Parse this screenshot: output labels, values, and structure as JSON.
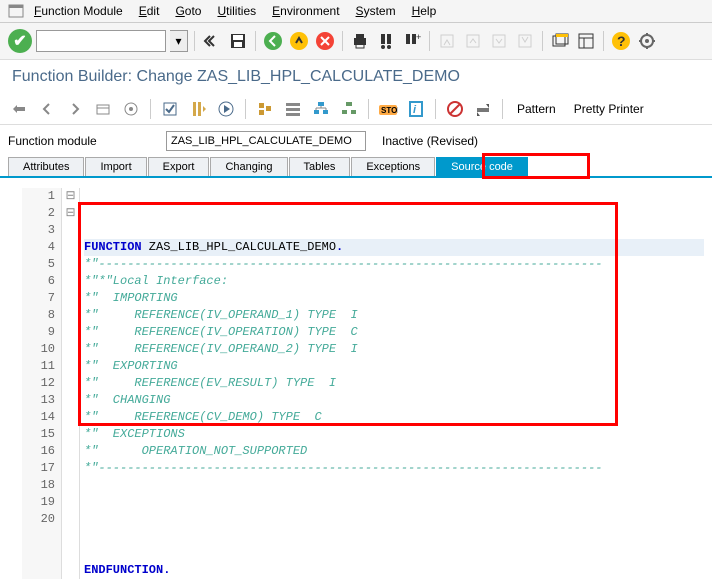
{
  "menubar": {
    "items": [
      "Function Module",
      "Edit",
      "Goto",
      "Utilities",
      "Environment",
      "System",
      "Help"
    ]
  },
  "title": "Function Builder: Change ZAS_LIB_HPL_CALCULATE_DEMO",
  "toolbar2": {
    "pattern": "Pattern",
    "pretty": "Pretty Printer"
  },
  "fm": {
    "label": "Function module",
    "value": "ZAS_LIB_HPL_CALCULATE_DEMO",
    "status": "Inactive (Revised)"
  },
  "tabs": [
    "Attributes",
    "Import",
    "Export",
    "Changing",
    "Tables",
    "Exceptions",
    "Source code"
  ],
  "code": {
    "lines": [
      {
        "n": 1,
        "fold": "⊟",
        "seg": [
          {
            "cls": "kw",
            "t": "FUNCTION"
          },
          {
            "cls": "ident",
            "t": " ZAS_LIB_HPL_CALCULATE_DEMO"
          },
          {
            "cls": "kw",
            "t": "."
          }
        ]
      },
      {
        "n": 2,
        "fold": "⊟",
        "seg": [
          {
            "cls": "cmt",
            "t": "*\"----------------------------------------------------------------------"
          }
        ]
      },
      {
        "n": 3,
        "fold": "",
        "seg": [
          {
            "cls": "cmt",
            "t": "*\"*\"Local Interface:"
          }
        ]
      },
      {
        "n": 4,
        "fold": "",
        "seg": [
          {
            "cls": "cmt",
            "t": "*\"  IMPORTING"
          }
        ]
      },
      {
        "n": 5,
        "fold": "",
        "seg": [
          {
            "cls": "cmt",
            "t": "*\"     REFERENCE(IV_OPERAND_1) TYPE  I"
          }
        ]
      },
      {
        "n": 6,
        "fold": "",
        "seg": [
          {
            "cls": "cmt",
            "t": "*\"     REFERENCE(IV_OPERATION) TYPE  C"
          }
        ]
      },
      {
        "n": 7,
        "fold": "",
        "seg": [
          {
            "cls": "cmt",
            "t": "*\"     REFERENCE(IV_OPERAND_2) TYPE  I"
          }
        ]
      },
      {
        "n": 8,
        "fold": "",
        "seg": [
          {
            "cls": "cmt",
            "t": "*\"  EXPORTING"
          }
        ]
      },
      {
        "n": 9,
        "fold": "",
        "seg": [
          {
            "cls": "cmt",
            "t": "*\"     REFERENCE(EV_RESULT) TYPE  I"
          }
        ]
      },
      {
        "n": 10,
        "fold": "",
        "seg": [
          {
            "cls": "cmt",
            "t": "*\"  CHANGING"
          }
        ]
      },
      {
        "n": 11,
        "fold": "",
        "seg": [
          {
            "cls": "cmt",
            "t": "*\"     REFERENCE(CV_DEMO) TYPE  C"
          }
        ]
      },
      {
        "n": 12,
        "fold": "",
        "seg": [
          {
            "cls": "cmt",
            "t": "*\"  EXCEPTIONS"
          }
        ]
      },
      {
        "n": 13,
        "fold": "",
        "seg": [
          {
            "cls": "cmt",
            "t": "*\"      OPERATION_NOT_SUPPORTED"
          }
        ]
      },
      {
        "n": 14,
        "fold": "",
        "seg": [
          {
            "cls": "cmt",
            "t": "*\"----------------------------------------------------------------------"
          }
        ]
      },
      {
        "n": 15,
        "fold": "",
        "seg": []
      },
      {
        "n": 16,
        "fold": "",
        "seg": []
      },
      {
        "n": 17,
        "fold": "",
        "seg": []
      },
      {
        "n": 18,
        "fold": "",
        "seg": []
      },
      {
        "n": 19,
        "fold": "",
        "seg": []
      },
      {
        "n": 20,
        "fold": "",
        "seg": [
          {
            "cls": "kw",
            "t": "ENDFUNCTION"
          },
          {
            "cls": "kw",
            "t": "."
          }
        ]
      }
    ]
  }
}
